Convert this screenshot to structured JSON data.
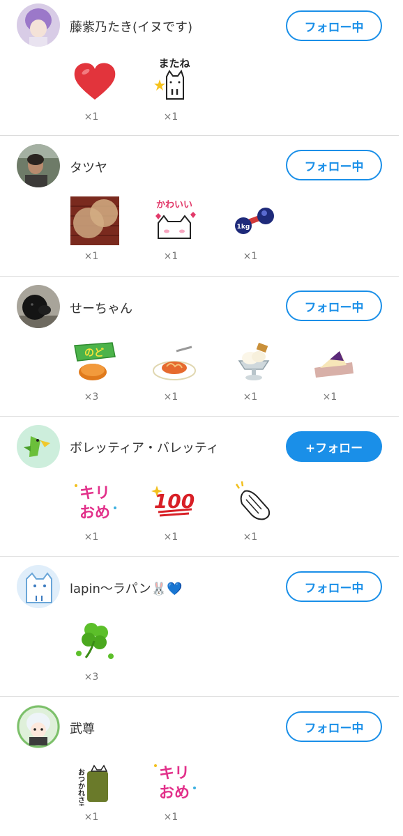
{
  "users": [
    {
      "name": "藤紫乃たき(イヌです)",
      "follow_label": "フォロー中",
      "gifts": [
        {
          "icon": "heart-sticker",
          "count": "×1"
        },
        {
          "icon": "matane-cat-sticker",
          "text": "またね",
          "count": "×1"
        }
      ]
    },
    {
      "name": "タツヤ",
      "follow_label": "フォロー中",
      "gifts": [
        {
          "icon": "brick-pattern-sticker",
          "count": "×1"
        },
        {
          "icon": "kawaii-cat-sticker",
          "text": "かわいい",
          "count": "×1"
        },
        {
          "icon": "dumbbell-sticker",
          "text": "1kg",
          "count": "×1"
        }
      ]
    },
    {
      "name": "せーちゃん",
      "follow_label": "フォロー中",
      "gifts": [
        {
          "icon": "nodo-candy-sticker",
          "text": "のど",
          "count": "×3"
        },
        {
          "icon": "pasta-sticker",
          "count": "×1"
        },
        {
          "icon": "ice-cream-sticker",
          "count": "×1"
        },
        {
          "icon": "sandwich-sticker",
          "count": "×1"
        }
      ]
    },
    {
      "name": "ボレッティア・バレッティ",
      "follow_label": "+フォロー",
      "gifts": [
        {
          "icon": "kiriome-sticker",
          "text1": "キリ",
          "text2": "おめ",
          "count": "×1"
        },
        {
          "icon": "hundred-sticker",
          "text": "100",
          "count": "×1"
        },
        {
          "icon": "clap-hands-sticker",
          "count": "×1"
        }
      ]
    },
    {
      "name": "lapin〜ラパン🐰💙",
      "follow_label": "フォロー中",
      "gifts": [
        {
          "icon": "clover-sticker",
          "count": "×3"
        }
      ]
    },
    {
      "name": "武尊",
      "follow_label": "フォロー中",
      "gifts": [
        {
          "icon": "otsukaresama-sticker",
          "text": "おつかれさま",
          "count": "×1"
        },
        {
          "icon": "kiriome-sticker",
          "text1": "キリ",
          "text2": "おめ",
          "count": "×1"
        }
      ]
    }
  ],
  "colors": {
    "accent": "#1a8fe8",
    "divider": "#dcdcdc",
    "count_text": "#777777"
  }
}
